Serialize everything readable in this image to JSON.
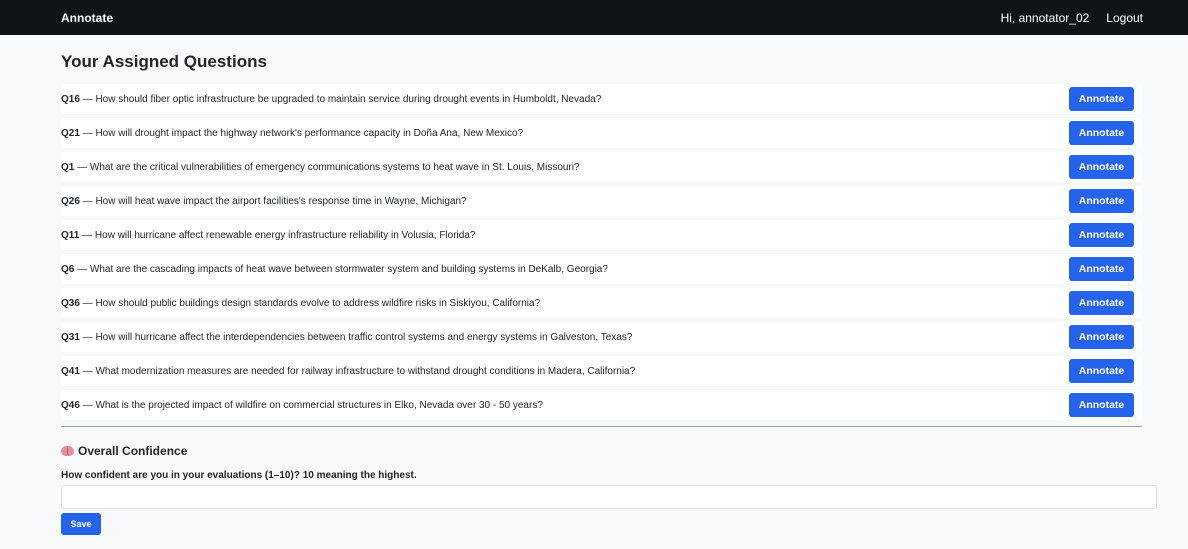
{
  "navbar": {
    "brand": "Annotate",
    "greeting": "Hi, annotator_02",
    "logout": "Logout"
  },
  "page": {
    "title": "Your Assigned Questions"
  },
  "questions": [
    {
      "id": "Q16",
      "text": " — How should fiber optic infrastructure be upgraded to maintain service during drought events in Humboldt, Nevada?",
      "action": "Annotate"
    },
    {
      "id": "Q21",
      "text": " — How will drought impact the highway network's performance capacity in Doña Ana, New Mexico?",
      "action": "Annotate"
    },
    {
      "id": "Q1",
      "text": " — What are the critical vulnerabilities of emergency communications systems to heat wave in St. Louis, Missouri?",
      "action": "Annotate"
    },
    {
      "id": "Q26",
      "text": " — How will heat wave impact the airport facilities's response time in Wayne, Michigan?",
      "action": "Annotate"
    },
    {
      "id": "Q11",
      "text": " — How will hurricane affect renewable energy infrastructure reliability in Volusia, Florida?",
      "action": "Annotate"
    },
    {
      "id": "Q6",
      "text": " — What are the cascading impacts of heat wave between stormwater system and building systems in DeKalb, Georgia?",
      "action": "Annotate"
    },
    {
      "id": "Q36",
      "text": " — How should public buildings design standards evolve to address wildfire risks in Siskiyou, California?",
      "action": "Annotate"
    },
    {
      "id": "Q31",
      "text": " — How will hurricane affect the interdependencies between traffic control systems and energy systems in Galveston, Texas?",
      "action": "Annotate"
    },
    {
      "id": "Q41",
      "text": " — What modernization measures are needed for railway infrastructure to withstand drought conditions in Madera, California?",
      "action": "Annotate"
    },
    {
      "id": "Q46",
      "text": " — What is the projected impact of wildfire on commercial structures in Elko, Nevada over 30 - 50 years?",
      "action": "Annotate"
    }
  ],
  "confidence": {
    "icon": "brain-icon",
    "title": "Overall Confidence",
    "label": "How confident are you in your evaluations (1–10)? 10 meaning the highest.",
    "value": "",
    "placeholder": "",
    "save_label": "Save"
  },
  "colors": {
    "navbar_bg": "#101419",
    "primary": "#2563eb",
    "page_bg": "#f8f9fa"
  }
}
